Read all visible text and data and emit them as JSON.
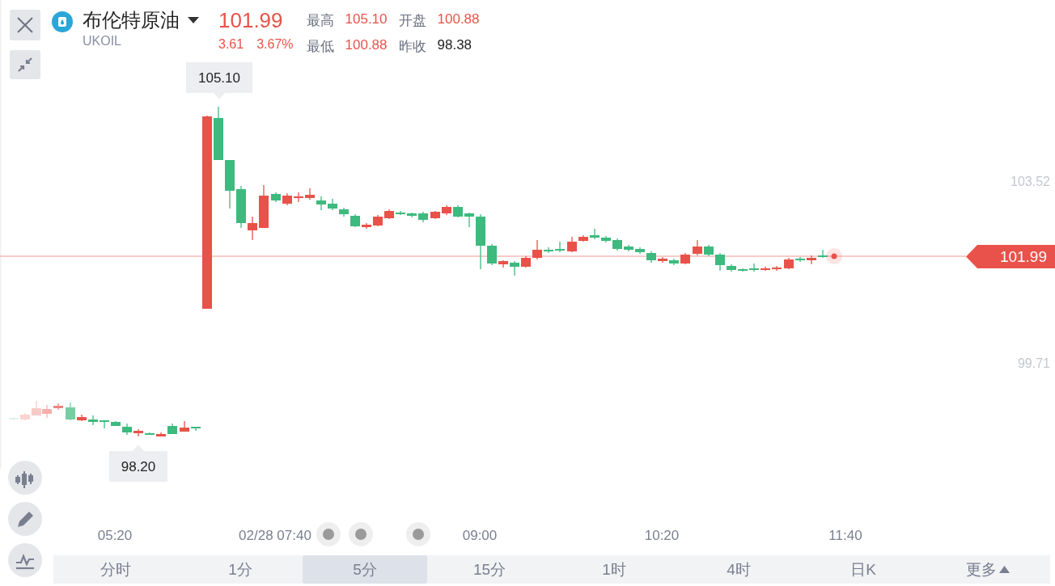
{
  "header": {
    "name": "布伦特原油",
    "symbol": "UKOIL",
    "price": "101.99",
    "change": "3.61",
    "change_percent": "3.67%",
    "stats": [
      {
        "label": "最高",
        "value": "105.10",
        "color": "#e8524a"
      },
      {
        "label": "开盘",
        "value": "100.88",
        "color": "#e8524a"
      },
      {
        "label": "最低",
        "value": "100.88",
        "color": "#e8524a"
      },
      {
        "label": "昨收",
        "value": "98.38",
        "color": "#222222"
      }
    ]
  },
  "chart": {
    "price_labels": [
      "103.52",
      "99.71"
    ],
    "current_price": "101.99",
    "high_label": "105.10",
    "low_label": "98.20",
    "time_labels": [
      "05:20",
      "02/28 07:40",
      "09:00",
      "10:20",
      "11:40"
    ]
  },
  "tabs": [
    {
      "label": "分时",
      "selected": false,
      "kind": "period"
    },
    {
      "label": "1分",
      "selected": false,
      "kind": "period"
    },
    {
      "label": "5分",
      "selected": true,
      "kind": "period"
    },
    {
      "label": "15分",
      "selected": false,
      "kind": "period"
    },
    {
      "label": "1时",
      "selected": false,
      "kind": "period"
    },
    {
      "label": "4时",
      "selected": false,
      "kind": "period"
    },
    {
      "label": "日K",
      "selected": false,
      "kind": "period"
    },
    {
      "label": "更多",
      "selected": false,
      "kind": "more"
    }
  ]
}
